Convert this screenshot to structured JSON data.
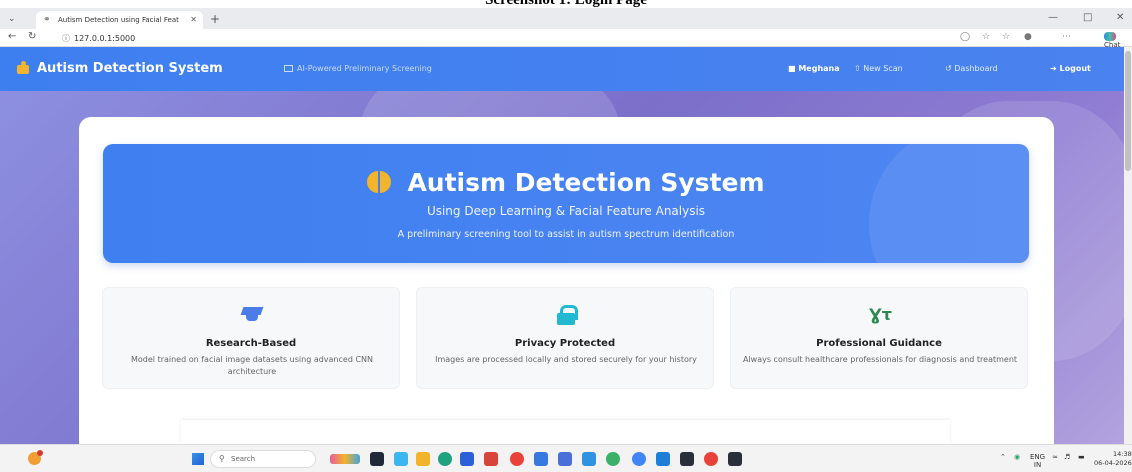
{
  "caption": "Screenshot 1: Login Page",
  "browser": {
    "tab_title": "Autism Detection using Facial Feat",
    "url": "127.0.0.1:5000",
    "chat_label": "Chat"
  },
  "nav": {
    "brand": "Autism Detection System",
    "tagline": "AI-Powered Preliminary Screening",
    "user": "Meghana",
    "new_scan": "New Scan",
    "dashboard": "Dashboard",
    "logout": "Logout"
  },
  "hero": {
    "title": "Autism Detection System",
    "subtitle": "Using Deep Learning & Facial Feature Analysis",
    "description": "A preliminary screening tool to assist in autism spectrum identification"
  },
  "features": [
    {
      "icon": "graduation-cap-icon",
      "title": "Research-Based",
      "description": "Model trained on facial image datasets using advanced CNN architecture"
    },
    {
      "icon": "lock-icon",
      "title": "Privacy Protected",
      "description": "Images are processed locally and stored securely for your history"
    },
    {
      "icon": "stethoscope-icon",
      "title": "Professional Guidance",
      "description": "Always consult healthcare professionals for diagnosis and treatment"
    }
  ],
  "taskbar": {
    "search_placeholder": "Search",
    "lang_primary": "ENG",
    "lang_secondary": "IN",
    "time": "14:38",
    "date": "06-04-2026"
  },
  "colors": {
    "nav_bg": "#4a82ef",
    "hero_bg": "#4f86f2",
    "accent_gold": "#f2b42b",
    "lock_cyan": "#21b9cf",
    "steth_green": "#2c8a4e"
  }
}
